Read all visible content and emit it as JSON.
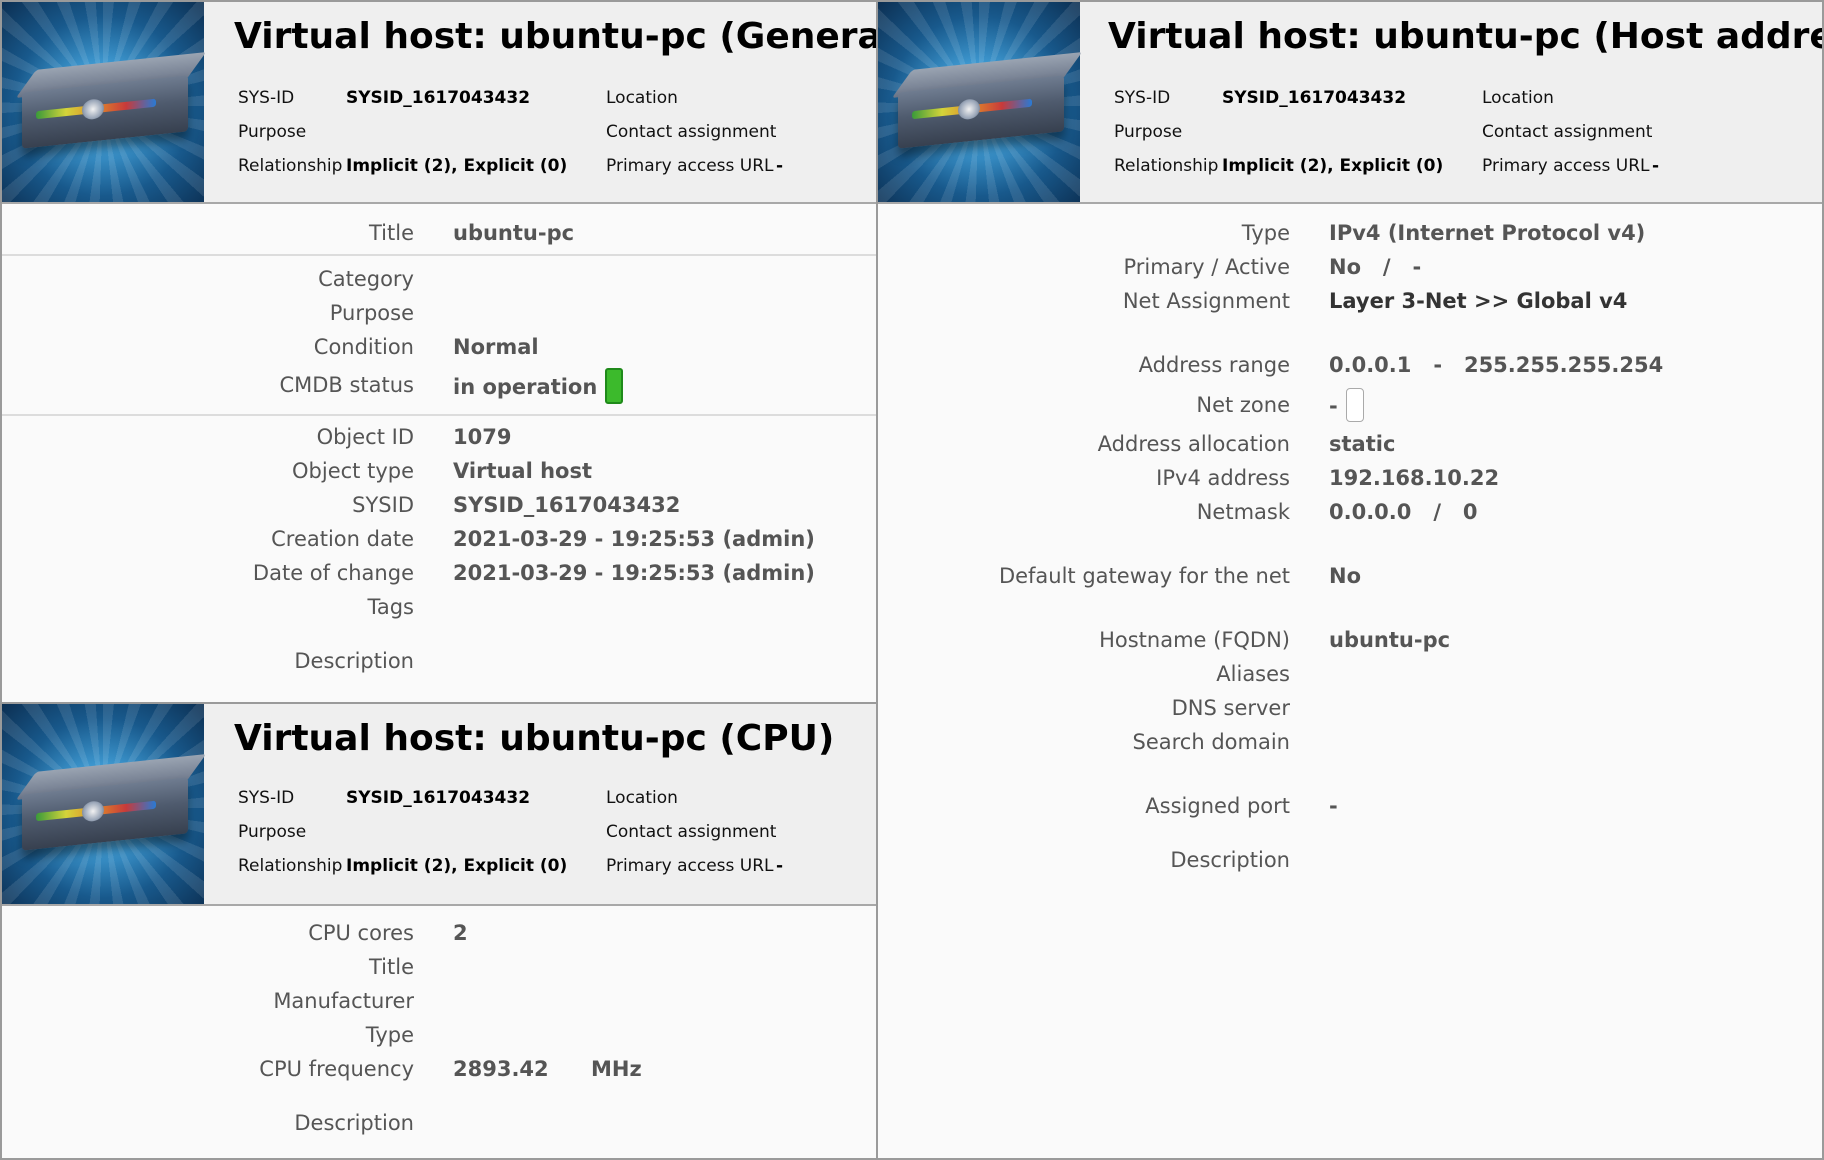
{
  "header": {
    "labels": {
      "sysid": "SYS-ID",
      "purpose": "Purpose",
      "relationship": "Relationship",
      "location": "Location",
      "contact": "Contact assignment",
      "url": "Primary access URL"
    },
    "sysid_value": "SYSID_1617043432",
    "relationship_value": "Implicit (2), Explicit (0)",
    "url_value": "-"
  },
  "general": {
    "title": "Virtual host: ubuntu-pc (General)",
    "fields": {
      "title_label": "Title",
      "title_value": "ubuntu-pc",
      "category_label": "Category",
      "purpose_label": "Purpose",
      "condition_label": "Condition",
      "condition_value": "Normal",
      "cmdb_label": "CMDB status",
      "cmdb_value": "in operation",
      "objid_label": "Object ID",
      "objid_value": "1079",
      "objtype_label": "Object type",
      "objtype_value": "Virtual host",
      "sysid_label": "SYSID",
      "sysid_value": "SYSID_1617043432",
      "created_label": "Creation date",
      "created_value": "2021-03-29 - 19:25:53 (admin)",
      "changed_label": "Date of change",
      "changed_value": "2021-03-29 - 19:25:53 (admin)",
      "tags_label": "Tags",
      "desc_label": "Description"
    },
    "cmdb_status_color": "#3cba2c"
  },
  "cpu": {
    "title": "Virtual host: ubuntu-pc (CPU)",
    "fields": {
      "cores_label": "CPU cores",
      "cores_value": "2",
      "title_label": "Title",
      "manufacturer_label": "Manufacturer",
      "type_label": "Type",
      "freq_label": "CPU frequency",
      "freq_value": "2893.42",
      "freq_unit": "MHz",
      "desc_label": "Description"
    }
  },
  "host": {
    "title": "Virtual host: ubuntu-pc (Host address)",
    "fields": {
      "type_label": "Type",
      "type_value": "IPv4 (Internet Protocol v4)",
      "primary_label": "Primary / Active",
      "primary_value": "No   /   -",
      "net_label": "Net Assignment",
      "net_value": "Layer 3-Net >> Global v4",
      "range_label": "Address range",
      "range_value": "0.0.0.1   -   255.255.255.254",
      "zone_label": "Net zone",
      "zone_value": "-",
      "alloc_label": "Address allocation",
      "alloc_value": "static",
      "ipv4_label": "IPv4 address",
      "ipv4_value": "192.168.10.22",
      "netmask_label": "Netmask",
      "netmask_value": "0.0.0.0   /   0",
      "gateway_label": "Default gateway for the net",
      "gateway_value": "No",
      "hostname_label": "Hostname (FQDN)",
      "hostname_value": "ubuntu-pc",
      "aliases_label": "Aliases",
      "dns_label": "DNS server",
      "search_label": "Search domain",
      "port_label": "Assigned port",
      "port_value": "-",
      "desc_label": "Description"
    }
  }
}
